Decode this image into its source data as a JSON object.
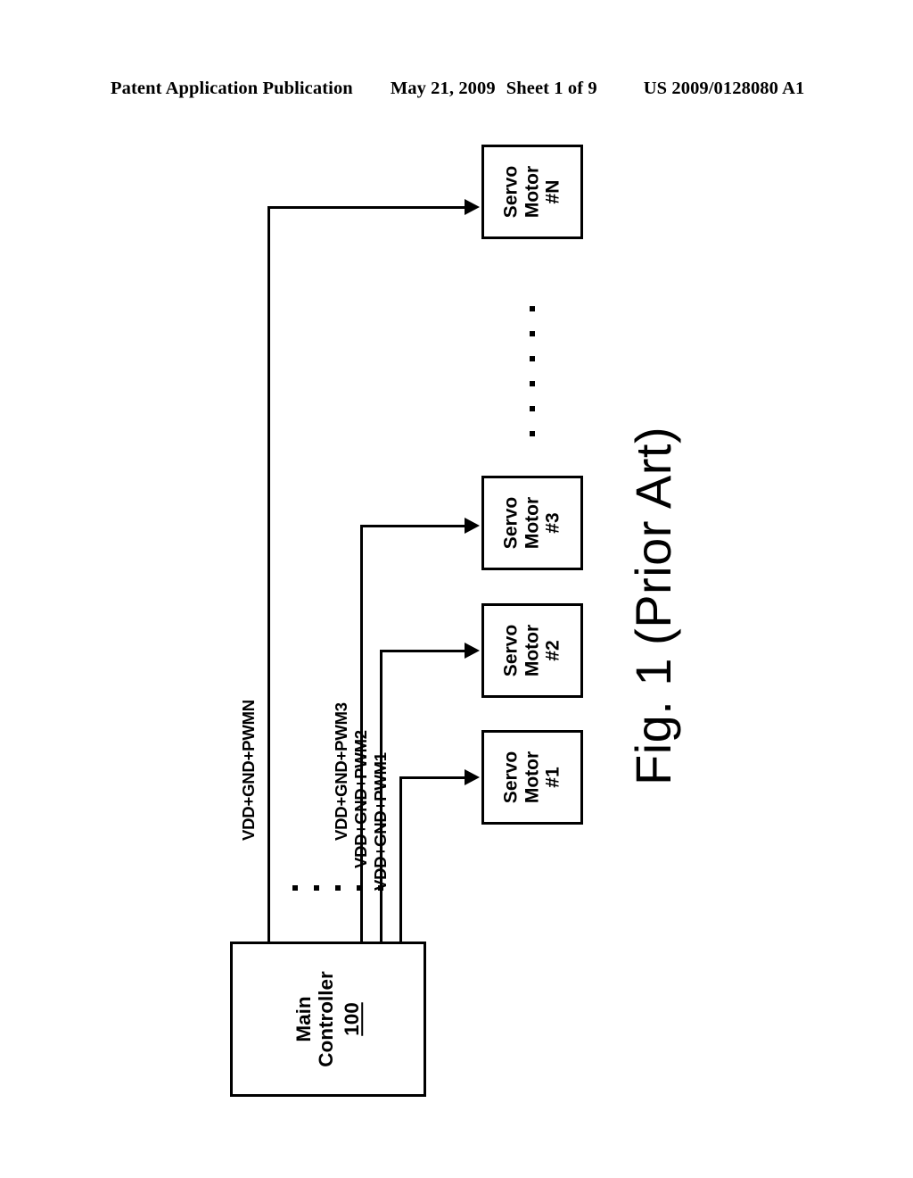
{
  "header": {
    "publication": "Patent Application Publication",
    "date": "May 21, 2009",
    "sheet": "Sheet 1 of 9",
    "pub_number": "US 2009/0128080 A1"
  },
  "figure": {
    "label": "Fig. 1",
    "note": "(Prior Art)"
  },
  "controller": {
    "line1": "Main",
    "line2": "Controller",
    "ref": "100"
  },
  "servo_motors": [
    {
      "line1": "Servo",
      "line2": "Motor",
      "line3": "#N"
    },
    {
      "line1": "Servo",
      "line2": "Motor",
      "line3": "#3"
    },
    {
      "line1": "Servo",
      "line2": "Motor",
      "line3": "#2"
    },
    {
      "line1": "Servo",
      "line2": "Motor",
      "line3": "#1"
    }
  ],
  "signals": [
    {
      "label": "VDD+GND+PWMN"
    },
    {
      "label": "VDD+GND+PWM3"
    },
    {
      "label": "VDD+GND+PWM2"
    },
    {
      "label": "VDD+GND+PWM1"
    }
  ],
  "ellipsis": {
    "vertical_dot_count": 6,
    "horizontal_dot_count": 5
  },
  "colors": {
    "ink": "#000000",
    "paper": "#ffffff"
  }
}
